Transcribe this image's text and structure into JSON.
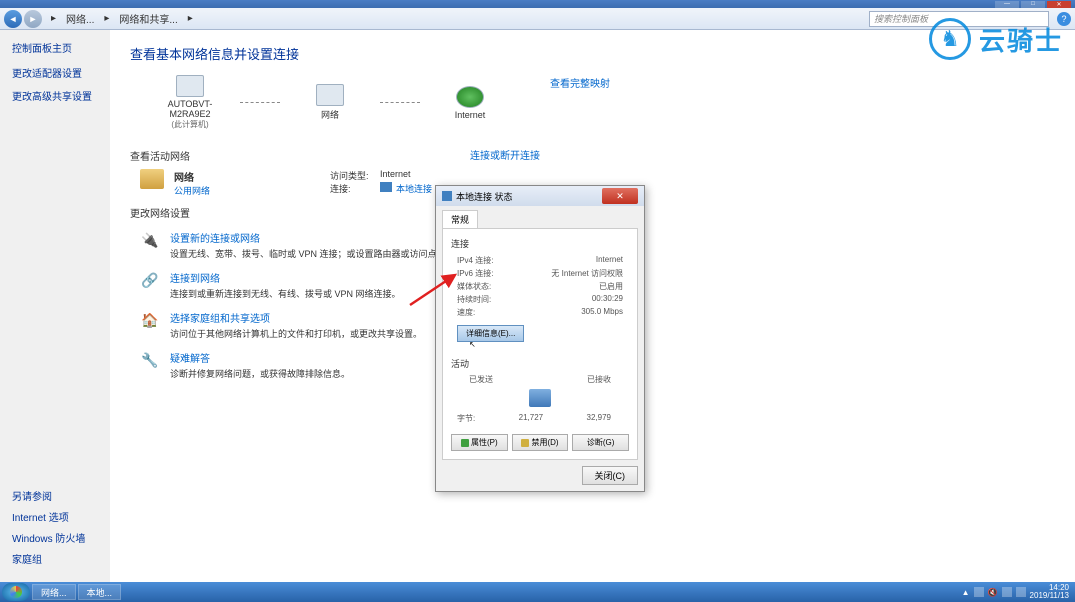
{
  "titlebar": {
    "min": "—",
    "max": "□",
    "close": "✕"
  },
  "nav": {
    "breadcrumb1": "网络...",
    "breadcrumb2": "网络和共享...",
    "search_placeholder": "搜索控制面板",
    "help": "?"
  },
  "sidebar": {
    "title": "控制面板主页",
    "links": [
      "更改适配器设置",
      "更改高级共享设置"
    ],
    "bottom_title": "另请参阅",
    "bottom_links": [
      "Internet 选项",
      "Windows 防火墙",
      "家庭组"
    ]
  },
  "content": {
    "title": "查看基本网络信息并设置连接",
    "map": {
      "node1": "AUTOBVT-M2RA9E2",
      "node1_sub": "(此计算机)",
      "node2": "网络",
      "node3": "Internet",
      "full_map": "查看完整映射"
    },
    "active_net_label": "查看活动网络",
    "connect_disconnect": "连接或断开连接",
    "network": {
      "name": "网络",
      "type": "公用网络",
      "access_label": "访问类型:",
      "access_val": "Internet",
      "conn_label": "连接:",
      "conn_val": "本地连接"
    },
    "change_settings_label": "更改网络设置",
    "settings": [
      {
        "icon": "🔌",
        "title": "设置新的连接或网络",
        "desc": "设置无线、宽带、拨号、临时或 VPN 连接；或设置路由器或访问点。"
      },
      {
        "icon": "🔗",
        "title": "连接到网络",
        "desc": "连接到或重新连接到无线、有线、拨号或 VPN 网络连接。"
      },
      {
        "icon": "🏠",
        "title": "选择家庭组和共享选项",
        "desc": "访问位于其他网络计算机上的文件和打印机，或更改共享设置。"
      },
      {
        "icon": "🔧",
        "title": "疑难解答",
        "desc": "诊断并修复网络问题，或获得故障排除信息。"
      }
    ]
  },
  "dialog": {
    "title": "本地连接 状态",
    "tab": "常规",
    "conn_section": "连接",
    "rows": [
      {
        "label": "IPv4 连接:",
        "val": "Internet"
      },
      {
        "label": "IPv6 连接:",
        "val": "无 Internet 访问权限"
      },
      {
        "label": "媒体状态:",
        "val": "已启用"
      },
      {
        "label": "持续时间:",
        "val": "00:30:29"
      },
      {
        "label": "速度:",
        "val": "305.0 Mbps"
      }
    ],
    "details_btn": "详细信息(E)...",
    "activity_section": "活动",
    "sent": "已发送",
    "received": "已接收",
    "bytes_label": "字节:",
    "sent_val": "21,727",
    "recv_val": "32,979",
    "btn_props": "属性(P)",
    "btn_disable": "禁用(D)",
    "btn_diag": "诊断(G)",
    "btn_close": "关闭(C)"
  },
  "watermark": {
    "text": "云骑士"
  },
  "taskbar": {
    "items": [
      "网络...",
      "本地..."
    ],
    "time": "14:20",
    "date": "2019/11/13"
  }
}
